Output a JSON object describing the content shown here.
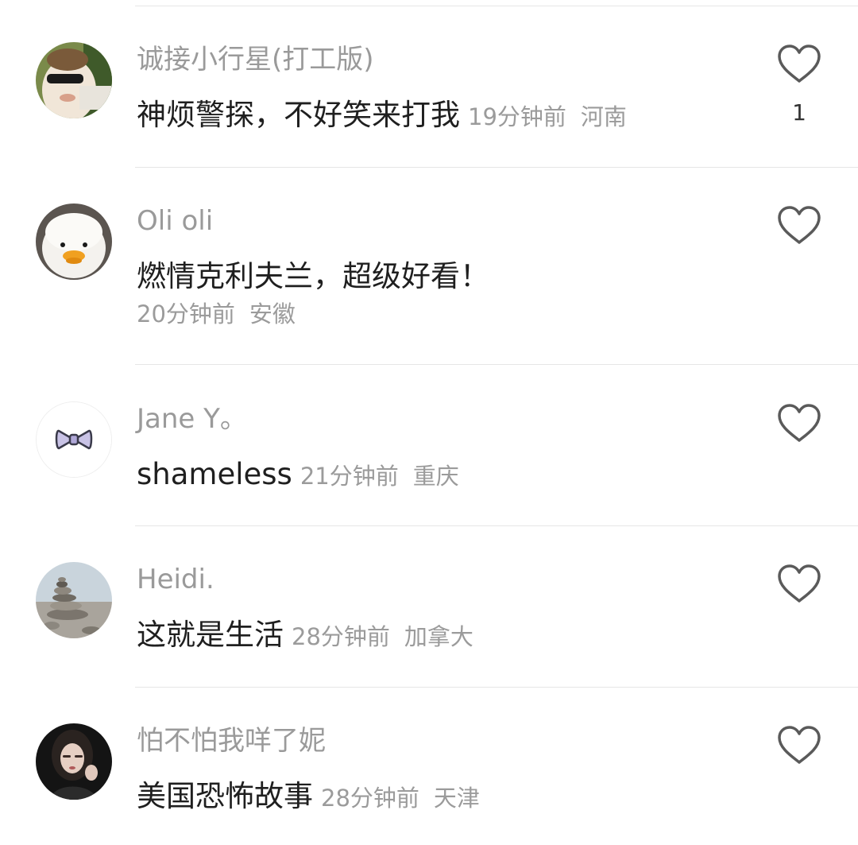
{
  "comments": [
    {
      "username": "诚接小行星(打工版)",
      "text": "神烦警探，不好笑来打我",
      "time": "19分钟前",
      "location": "河南",
      "likes": "1",
      "avatar_icon": "sunglasses-kid-avatar"
    },
    {
      "username": "Oli oli",
      "text": "燃情克利夫兰，超级好看！",
      "time": "20分钟前",
      "location": "安徽",
      "likes": "",
      "avatar_icon": "fluffy-duck-avatar"
    },
    {
      "username": "Jane Y。",
      "text": "shameless",
      "time": "21分钟前",
      "location": "重庆",
      "likes": "",
      "avatar_icon": "bow-avatar"
    },
    {
      "username": "Heidi.",
      "text": "这就是生活",
      "time": "28分钟前",
      "location": "加拿大",
      "likes": "",
      "avatar_icon": "stacked-stones-avatar"
    },
    {
      "username": "怕不怕我咩了妮",
      "text": "美国恐怖故事",
      "time": "28分钟前",
      "location": "天津",
      "likes": "",
      "avatar_icon": "girl-portrait-avatar"
    }
  ],
  "colors": {
    "username": "#9a9a9a",
    "text": "#1f1f1f",
    "meta": "#9b9b9b",
    "divider": "#e6e6e6",
    "heart_stroke": "#5a5a5a"
  }
}
